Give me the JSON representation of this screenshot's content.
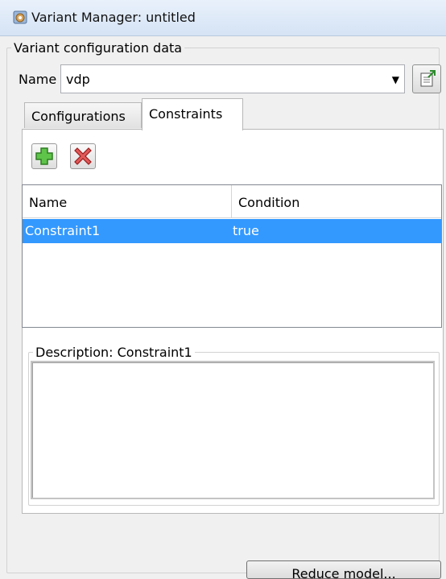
{
  "window": {
    "title": "Variant Manager: untitled",
    "icon": "variant-manager-icon"
  },
  "config_group": {
    "legend": "Variant configuration data"
  },
  "name_field": {
    "label": "Name",
    "value": "vdp"
  },
  "tabs": [
    {
      "label": "Configurations",
      "selected": false
    },
    {
      "label": "Constraints",
      "selected": true
    }
  ],
  "toolbar": {
    "add_icon": "add-icon",
    "delete_icon": "delete-icon",
    "export_icon": "export-icon"
  },
  "table": {
    "columns": [
      "Name",
      "Condition"
    ],
    "rows": [
      {
        "name": "Constraint1",
        "condition": "true",
        "selected": true
      }
    ]
  },
  "description": {
    "legend": "Description: Constraint1",
    "text": ""
  },
  "actions": {
    "reduce_label": "Reduce model..."
  },
  "colors": {
    "selection": "#3399ff",
    "window_bg": "#f0f0f0"
  }
}
